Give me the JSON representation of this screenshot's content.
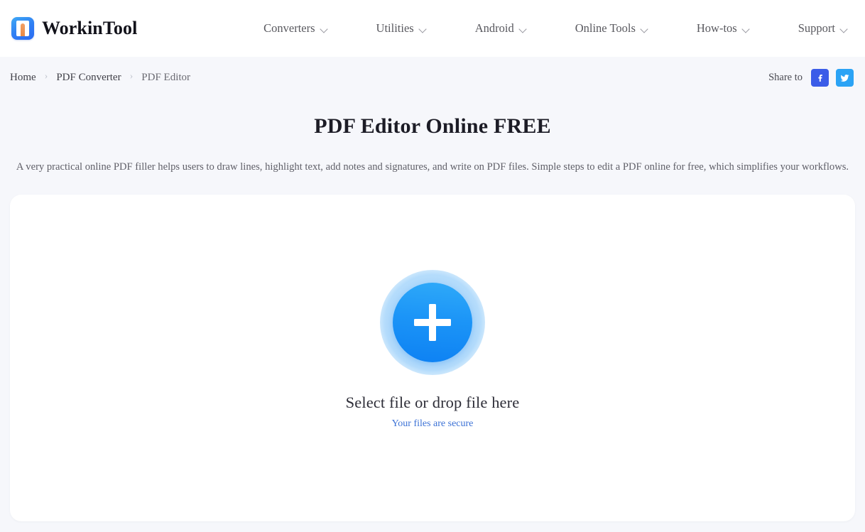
{
  "brand": {
    "name": "WorkinTool",
    "logo_icon": "workintool-logo-icon",
    "logo_color": "#2f7df4",
    "logo_accent": "#e98a46"
  },
  "nav": {
    "items": [
      {
        "label": "Converters",
        "icon": "chevron-down-icon"
      },
      {
        "label": "Utilities",
        "icon": "chevron-down-icon"
      },
      {
        "label": "Android",
        "icon": "chevron-down-icon"
      },
      {
        "label": "Online Tools",
        "icon": "chevron-down-icon"
      },
      {
        "label": "How-tos",
        "icon": "chevron-down-icon"
      },
      {
        "label": "Support",
        "icon": "chevron-down-icon"
      }
    ]
  },
  "breadcrumb": {
    "items": [
      {
        "label": "Home"
      },
      {
        "label": "PDF Converter"
      },
      {
        "label": "PDF Editor"
      }
    ],
    "separator": "›"
  },
  "share": {
    "label": "Share to",
    "buttons": [
      {
        "name": "facebook",
        "icon": "facebook-icon",
        "color": "#3b5ce8"
      },
      {
        "name": "twitter",
        "icon": "twitter-icon",
        "color": "#2ba3f5"
      }
    ]
  },
  "hero": {
    "title": "PDF Editor Online FREE",
    "description": "A very practical online PDF filler helps users to draw lines, highlight text, add notes and signatures, and write on PDF files. Simple steps to edit a PDF online for free, which simplifies your workflows."
  },
  "dropzone": {
    "plus_icon": "plus-icon",
    "title": "Select file or drop file here",
    "secure_note": "Your files are secure",
    "accent_color": "#1c95f7",
    "halo_color": "#a8d6fa",
    "link_color": "#3c72d6"
  },
  "page": {
    "background": "#f6f7fb",
    "card_background": "#ffffff"
  }
}
